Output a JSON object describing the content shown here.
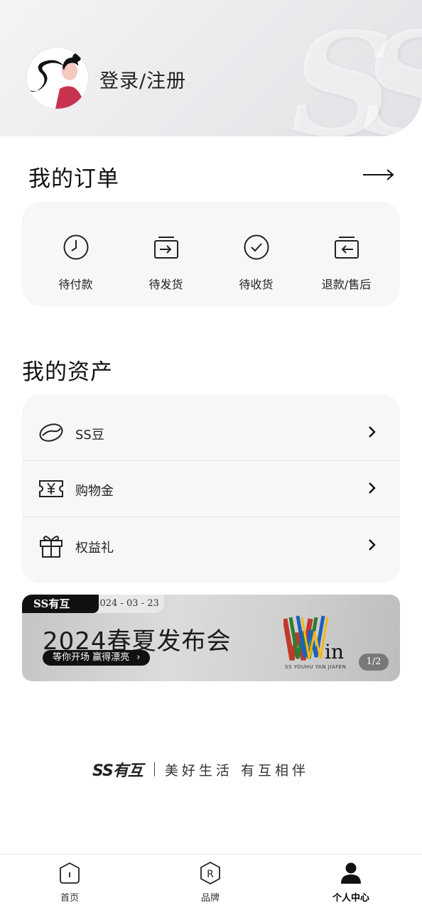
{
  "header": {
    "login_label": "登录/注册",
    "background_mark": "SS"
  },
  "orders": {
    "title": "我的订单",
    "more_icon": "arrow-right-icon",
    "items": [
      {
        "label": "待付款",
        "icon": "clock-icon"
      },
      {
        "label": "待发货",
        "icon": "ship-box-icon"
      },
      {
        "label": "待收货",
        "icon": "check-circle-icon"
      },
      {
        "label": "退款/售后",
        "icon": "return-box-icon"
      }
    ]
  },
  "assets": {
    "title": "我的资产",
    "items": [
      {
        "label": "SS豆",
        "icon": "bean-icon"
      },
      {
        "label": "购物金",
        "icon": "yen-ticket-icon"
      },
      {
        "label": "权益礼",
        "icon": "gift-icon"
      }
    ]
  },
  "banner": {
    "tag": "SS有互",
    "date": "2024 - 03 - 23",
    "title": "2024春夏发布会",
    "cta": "等你开场 赢得漂亮",
    "logo_text": "Win",
    "logo_subtext": "SS YOUHU YAN JIAFEN",
    "page_indicator": "1/2"
  },
  "slogan": {
    "brand": "SS有互",
    "text": "美好生活 有互相伴"
  },
  "tabbar": {
    "items": [
      {
        "label": "首页",
        "icon": "home-icon",
        "active": false
      },
      {
        "label": "品牌",
        "icon": "brand-r-icon",
        "active": false
      },
      {
        "label": "个人中心",
        "icon": "person-icon",
        "active": true
      }
    ]
  },
  "colors": {
    "card_background": "#f6f7f9",
    "text": "#222222",
    "tab_active": "#000000"
  }
}
